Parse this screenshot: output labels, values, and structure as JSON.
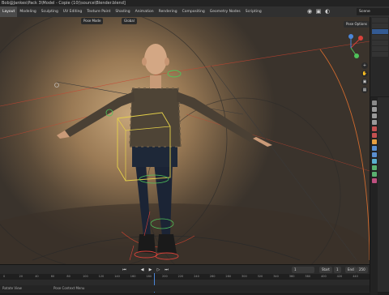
{
  "window": {
    "title": "Bob@Jankes\\Pack 3\\Model - Copie (10)\\source\\Blender.blend]"
  },
  "workspaces": [
    "Layout",
    "Modeling",
    "Sculpting",
    "UV Editing",
    "Texture Paint",
    "Shading",
    "Animation",
    "Rendering",
    "Compositing",
    "Geometry Nodes",
    "Scripting"
  ],
  "active_workspace": "Layout",
  "scene_name": "Scene",
  "viewport": {
    "mode": "Pose Mode",
    "global": "Global",
    "pose_options": "Pose Options"
  },
  "timeline": {
    "current_frame": "1",
    "start_label": "Start",
    "start_value": "1",
    "end_label": "End",
    "end_value": "250",
    "ruler_ticks": [
      "0",
      "20",
      "40",
      "60",
      "80",
      "100",
      "120",
      "140",
      "160",
      "180",
      "200",
      "220",
      "240",
      "260",
      "280",
      "300",
      "320",
      "340",
      "360",
      "380",
      "400",
      "420",
      "440"
    ]
  },
  "statusbar": {
    "left": "Rotate View",
    "right": "Pose Context Menu"
  },
  "colors": {
    "accent": "#4b86d8",
    "bone_yellow": "#e5d14a",
    "bone_green": "#4fc35a",
    "bone_red": "#d9413a"
  }
}
